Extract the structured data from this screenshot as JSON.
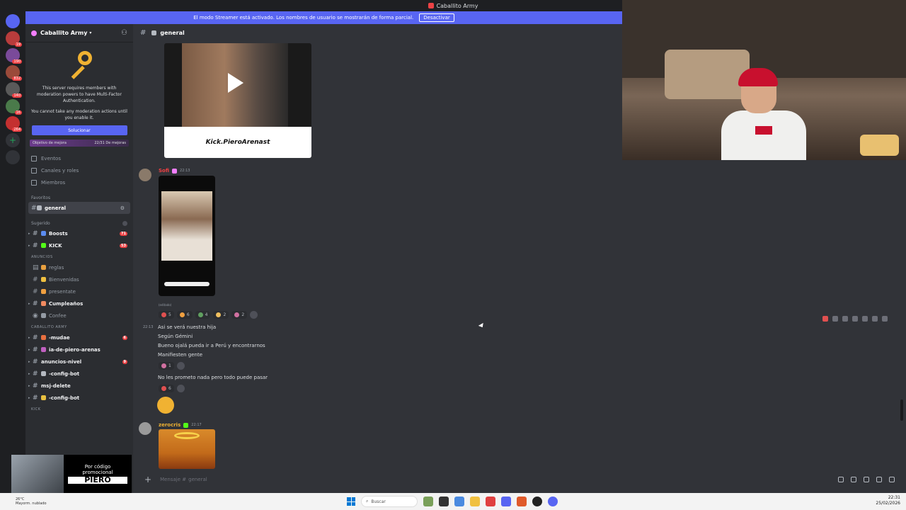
{
  "window": {
    "title": "Caballito Army"
  },
  "banner": {
    "text": "El modo Streamer está activado. Los nombres de usuario se mostrarán de forma parcial.",
    "button": "Desactivar"
  },
  "servers": {
    "badges": [
      "19",
      "190",
      "832",
      "140",
      "16",
      "264"
    ]
  },
  "guild": {
    "name": "Caballito Army",
    "mfa_text_1": "This server requires members with moderation powers to have Multi-Factor Authentication.",
    "mfa_text_2": "You cannot take any moderation actions until you enable it.",
    "mfa_button": "Solucionar",
    "boost_label": "Objetivo de mejora",
    "boost_progress": "22/31 De mejoras",
    "nav": [
      {
        "label": "Eventos",
        "icon": "calendar-icon"
      },
      {
        "label": "Canales y roles",
        "icon": "list-icon"
      },
      {
        "label": "Miembros",
        "icon": "members-icon"
      }
    ],
    "favorites_label": "Favoritos",
    "favorites": [
      {
        "label": "general"
      }
    ],
    "suggested_label": "Sugerido",
    "suggested": [
      {
        "label": "Boosts",
        "count": "71"
      },
      {
        "label": "KICK",
        "count": "53"
      }
    ],
    "cat_anuncios": "ANUNCIOS",
    "anuncios": [
      {
        "label": "reglas"
      },
      {
        "label": "Bienvenidas"
      },
      {
        "label": "presentate"
      },
      {
        "label": "Cumpleaños"
      },
      {
        "label": "Confee"
      }
    ],
    "cat_army": "CABALLITO ARMY",
    "army": [
      {
        "label": "-mudae",
        "count": "6"
      },
      {
        "label": "ia-de-piero-arenas",
        "count": ""
      },
      {
        "label": "anuncios-nivel",
        "count": "9"
      },
      {
        "label": "-config-bot",
        "count": ""
      },
      {
        "label": "msj-delete",
        "count": ""
      },
      {
        "label": "-config-bot",
        "count": ""
      }
    ],
    "cat_kick": "KICK"
  },
  "promo": {
    "line1": "Por código",
    "line2": "promocional",
    "code": "PIERO"
  },
  "channel": {
    "name": "general"
  },
  "messages": {
    "video_caption": "Kick.PieroArenast",
    "author1": "Sofi",
    "time1": "22:13",
    "edited": "(editado)",
    "reactions1": [
      "5",
      "6",
      "4",
      "2",
      "2"
    ],
    "stamp2": "22:13",
    "lines": [
      "Asi se verá nuestra hija",
      "Según Gémini",
      "Bueno ojalá pueda ir a Perú y encontrarnos",
      "Manifiesten gente"
    ],
    "reactions2": [
      "1"
    ],
    "line5": "No les prometo nada pero todo puede pasar",
    "reactions3": [
      "6"
    ],
    "author2": "zerocris",
    "time2": "22:17"
  },
  "composer": {
    "placeholder": "Mensaje #",
    "channel": "general"
  },
  "taskbar": {
    "weather_temp": "26°C",
    "weather_desc": "Mayorm. nublado",
    "search": "Buscar",
    "time": "22:31",
    "date": "25/02/2026"
  }
}
